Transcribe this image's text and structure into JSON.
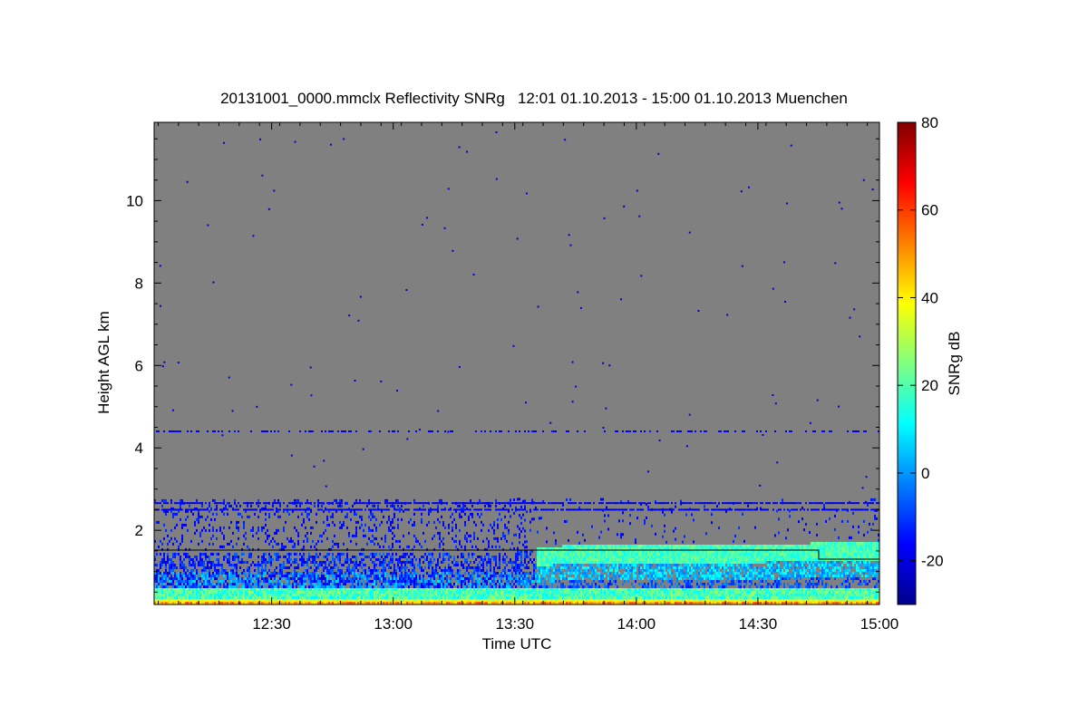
{
  "chart_data": {
    "type": "heatmap",
    "title": "20131001_0000.mmclx Reflectivity SNRg   12:01 01.10.2013 - 15:00 01.10.2013 Muenchen",
    "xlabel": "Time UTC",
    "ylabel": "Height AGL km",
    "colorbar_label": "SNRg dB",
    "x_range_minutes_utc": [
      721,
      900
    ],
    "x_ticks": [
      {
        "minute": 750,
        "label": "12:30"
      },
      {
        "minute": 780,
        "label": "13:00"
      },
      {
        "minute": 810,
        "label": "13:30"
      },
      {
        "minute": 840,
        "label": "14:00"
      },
      {
        "minute": 870,
        "label": "14:30"
      },
      {
        "minute": 900,
        "label": "15:00"
      }
    ],
    "ylim_km": [
      0.2,
      11.9
    ],
    "y_ticks": [
      2,
      4,
      6,
      8,
      10
    ],
    "colorbar_range_db": [
      -30,
      80
    ],
    "colorbar_ticks": [
      -20,
      0,
      20,
      40,
      60,
      80
    ],
    "background_color": "#808080",
    "colormap": "jet",
    "features": {
      "surface_layer_km": [
        0.2,
        0.6
      ],
      "boundary_layer_top_km": [
        {
          "minute": 721,
          "height": 1.5
        },
        {
          "minute": 808,
          "height": 1.5
        },
        {
          "minute": 820,
          "height": 1.65
        },
        {
          "minute": 885,
          "height": 1.72
        },
        {
          "minute": 900,
          "height": 1.72
        }
      ],
      "black_line_km": [
        {
          "minute": 721,
          "height": 1.52
        },
        {
          "minute": 885,
          "height": 1.52
        },
        {
          "minute": 885,
          "height": 1.3
        },
        {
          "minute": 900,
          "height": 1.3
        }
      ],
      "clutter_layers_km": [
        2.5,
        2.66,
        4.4
      ]
    }
  }
}
